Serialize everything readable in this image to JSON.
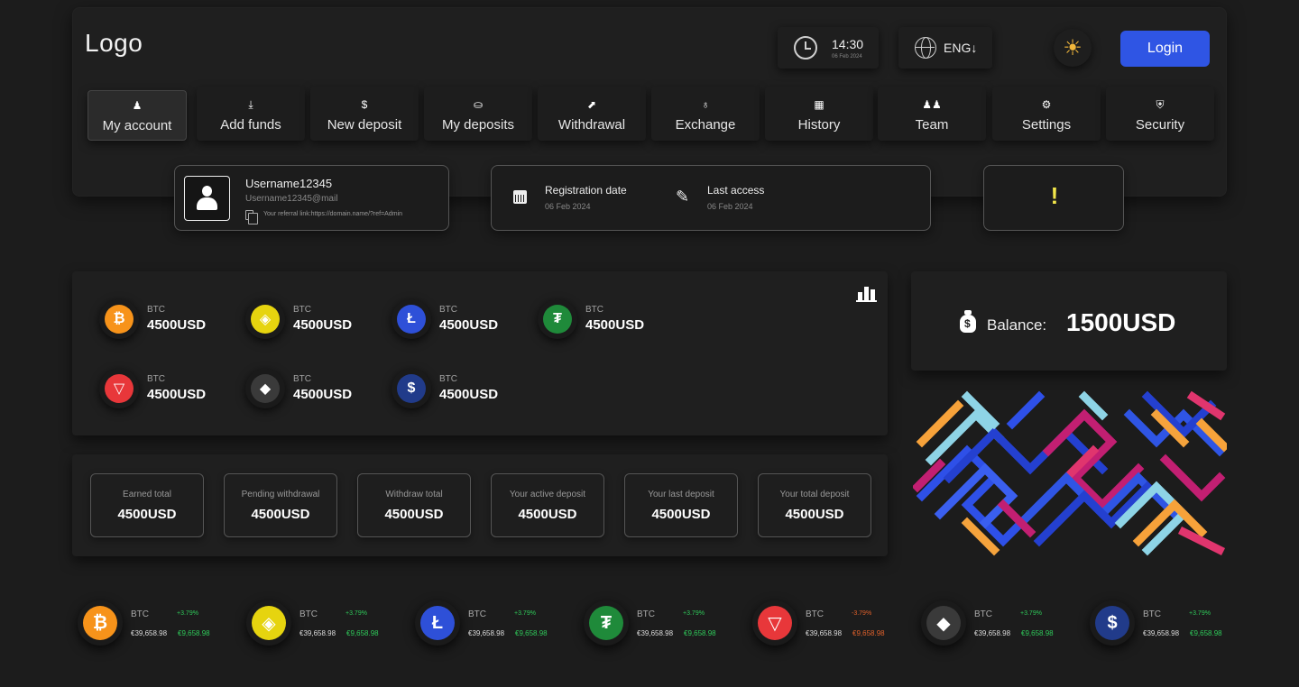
{
  "header": {
    "logo": "Logo",
    "time": "14:30",
    "date": "06 Feb 2024",
    "language": "ENG",
    "language_arrow": "↓",
    "login_label": "Login",
    "theme_icon": "sun-icon"
  },
  "nav": [
    {
      "label": "My account",
      "icon": "user-icon",
      "glyph": "♟"
    },
    {
      "label": "Add funds",
      "icon": "download-icon",
      "glyph": "⤓"
    },
    {
      "label": "New deposit",
      "icon": "dollar-icon",
      "glyph": "$"
    },
    {
      "label": "My deposits",
      "icon": "coins-icon",
      "glyph": "⛀"
    },
    {
      "label": "Withdrawal",
      "icon": "chart-up-icon",
      "glyph": "⬈"
    },
    {
      "label": "Exchange",
      "icon": "money-bag-icon",
      "glyph": "♁"
    },
    {
      "label": "History",
      "icon": "calendar-icon",
      "glyph": "▦"
    },
    {
      "label": "Team",
      "icon": "users-icon",
      "glyph": "♟♟"
    },
    {
      "label": "Settings",
      "icon": "gear-icon",
      "glyph": "⚙"
    },
    {
      "label": "Security",
      "icon": "shield-icon",
      "glyph": "⛨"
    }
  ],
  "profile": {
    "username": "Username12345",
    "email": "Username12345@mail",
    "referral": "Your referral link:https://domain.name/?ref=Admin",
    "registration_label": "Registration date",
    "registration_date": "06 Feb 2024",
    "last_access_label": "Last access",
    "last_access_date": "06 Feb 2024",
    "alert": "!"
  },
  "coins": [
    {
      "symbol": "BTC",
      "value": "4500USD",
      "icon": "bitcoin-icon",
      "glyph": "₿",
      "bg": "#f7931a"
    },
    {
      "symbol": "BTC",
      "value": "4500USD",
      "icon": "binance-icon",
      "glyph": "◈",
      "bg": "#e6d40f"
    },
    {
      "symbol": "BTC",
      "value": "4500USD",
      "icon": "litecoin-icon",
      "glyph": "Ł",
      "bg": "#2e50d8"
    },
    {
      "symbol": "BTC",
      "value": "4500USD",
      "icon": "tether-icon",
      "glyph": "₮",
      "bg": "#1f8a3a"
    },
    {
      "symbol": "BTC",
      "value": "4500USD",
      "icon": "tron-icon",
      "glyph": "▽",
      "bg": "#e8373a"
    },
    {
      "symbol": "BTC",
      "value": "4500USD",
      "icon": "ethereum-icon",
      "glyph": "◆",
      "bg": "#3a3a3a"
    },
    {
      "symbol": "BTC",
      "value": "4500USD",
      "icon": "usdc-icon",
      "glyph": "$",
      "bg": "#213b8a"
    }
  ],
  "stats": [
    {
      "label": "Earned total",
      "value": "4500USD"
    },
    {
      "label": "Pending withdrawal",
      "value": "4500USD"
    },
    {
      "label": "Withdraw total",
      "value": "4500USD"
    },
    {
      "label": "Your active deposit",
      "value": "4500USD"
    },
    {
      "label": "Your last deposit",
      "value": "4500USD"
    },
    {
      "label": "Your total deposit",
      "value": "4500USD"
    }
  ],
  "balance": {
    "label": "Balance:",
    "value": "1500USD"
  },
  "ticker": [
    {
      "symbol": "BTC",
      "price": "€39,658.98",
      "change": "+3.79%",
      "eur": "€9,658.98",
      "trend": "up",
      "icon": "bitcoin-icon",
      "glyph": "₿",
      "bg": "#f7931a"
    },
    {
      "symbol": "BTC",
      "price": "€39,658.98",
      "change": "+3.79%",
      "eur": "€9,658.98",
      "trend": "up",
      "icon": "binance-icon",
      "glyph": "◈",
      "bg": "#e6d40f"
    },
    {
      "symbol": "BTC",
      "price": "€39,658.98",
      "change": "+3.79%",
      "eur": "€9,658.98",
      "trend": "up",
      "icon": "litecoin-icon",
      "glyph": "Ł",
      "bg": "#2e50d8"
    },
    {
      "symbol": "BTC",
      "price": "€39,658.98",
      "change": "+3.79%",
      "eur": "€9,658.98",
      "trend": "up",
      "icon": "tether-icon",
      "glyph": "₮",
      "bg": "#1f8a3a"
    },
    {
      "symbol": "BTC",
      "price": "€39,658.98",
      "change": "-3.79%",
      "eur": "€9,658.98",
      "trend": "down",
      "icon": "tron-icon",
      "glyph": "▽",
      "bg": "#e8373a"
    },
    {
      "symbol": "BTC",
      "price": "€39,658.98",
      "change": "+3.79%",
      "eur": "€9,658.98",
      "trend": "up",
      "icon": "ethereum-icon",
      "glyph": "◆",
      "bg": "#3a3a3a"
    },
    {
      "symbol": "BTC",
      "price": "€39,658.98",
      "change": "+3.79%",
      "eur": "€9,658.98",
      "trend": "up",
      "icon": "usdc-icon",
      "glyph": "$",
      "bg": "#213b8a"
    }
  ],
  "colors": {
    "accent": "#2f55e4",
    "up": "#2fca5a",
    "down": "#e0612b",
    "alert": "#f2e64a"
  }
}
